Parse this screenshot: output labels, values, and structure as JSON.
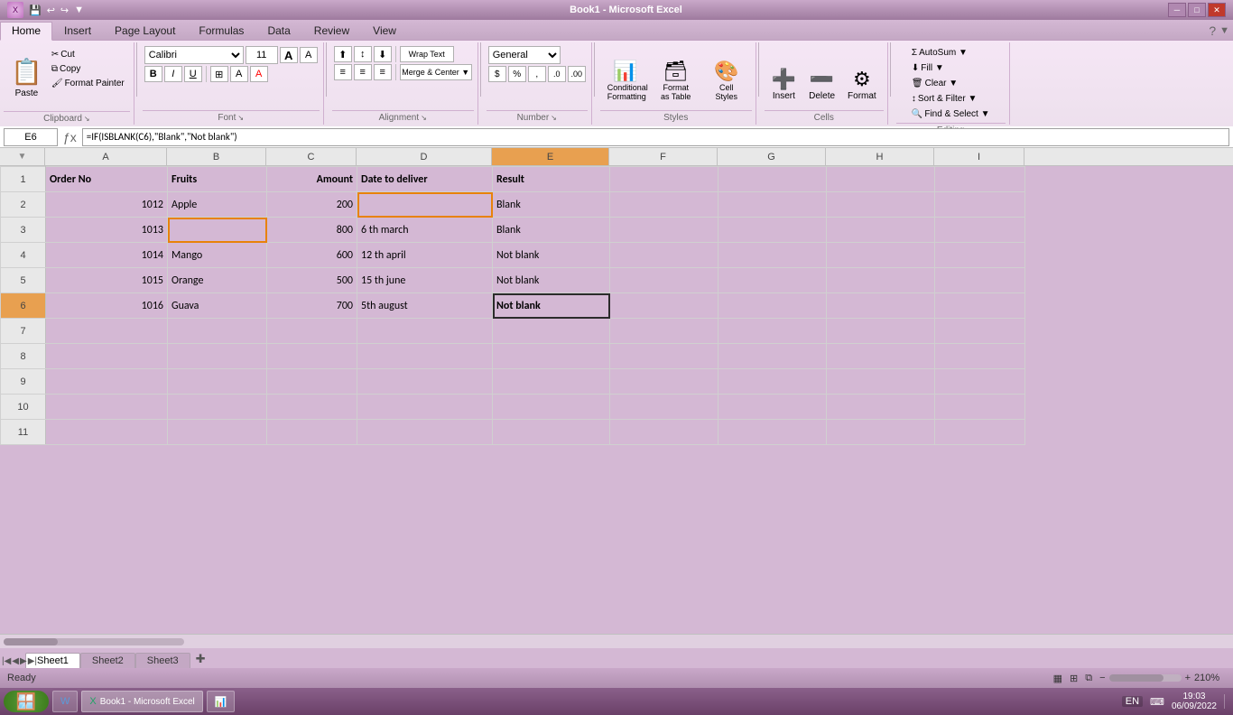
{
  "titlebar": {
    "title": "Book1 - Microsoft Excel",
    "minimize": "─",
    "restore": "□",
    "close": "✕"
  },
  "ribbon_tabs": [
    "Home",
    "Insert",
    "Page Layout",
    "Formulas",
    "Data",
    "Review",
    "View"
  ],
  "active_tab": "Home",
  "clipboard_group": {
    "label": "Clipboard",
    "paste": "Paste",
    "cut": "Cut",
    "copy": "Copy",
    "format_painter": "Format Painter"
  },
  "font_group": {
    "label": "Font",
    "font_name": "Calibri",
    "font_size": "11",
    "bold": "B",
    "italic": "I",
    "underline": "U"
  },
  "alignment_group": {
    "label": "Alignment",
    "wrap_text": "Wrap Text",
    "merge_center": "Merge & Center ▼"
  },
  "number_group": {
    "label": "Number",
    "format": "General"
  },
  "styles_group": {
    "label": "Styles",
    "conditional": "Conditional Formatting",
    "format_table": "Format as Table",
    "cell_styles": "Cell Styles"
  },
  "cells_group": {
    "label": "Cells",
    "insert": "Insert",
    "delete": "Delete",
    "format": "Format"
  },
  "editing_group": {
    "label": "Editing",
    "autosum": "AutoSum ▼",
    "fill": "Fill ▼",
    "clear": "Clear ▼",
    "sort_filter": "Sort & Filter ▼",
    "find_select": "Find & Select ▼"
  },
  "formula_bar": {
    "cell_ref": "E6",
    "formula": "=IF(ISBLANK(C6),\"Blank\",\"Not blank\")"
  },
  "columns": [
    "A",
    "B",
    "C",
    "D",
    "E",
    "F",
    "G",
    "H",
    "I"
  ],
  "rows": [
    1,
    2,
    3,
    4,
    5,
    6,
    7,
    8,
    9,
    10,
    11
  ],
  "headers": [
    "Order No",
    "Fruits",
    "Amount",
    "Date to deliver",
    "Result",
    "",
    "",
    "",
    ""
  ],
  "data": [
    [
      "1012",
      "Apple",
      "200",
      "",
      "Blank"
    ],
    [
      "1013",
      "",
      "800",
      "6 th march",
      "Blank"
    ],
    [
      "1014",
      "Mango",
      "600",
      "12 th april",
      "Not blank"
    ],
    [
      "1015",
      "Orange",
      "500",
      "15 th june",
      "Not blank"
    ],
    [
      "1016",
      "Guava",
      "700",
      "5th august",
      "Not blank"
    ]
  ],
  "sheet_tabs": [
    "Sheet1",
    "Sheet2",
    "Sheet3"
  ],
  "active_sheet": "Sheet1",
  "status": {
    "ready": "Ready",
    "zoom": "210%"
  },
  "taskbar": {
    "start": "start",
    "items": [
      "W",
      "Excel"
    ],
    "time": "19:03",
    "date": "06/09/2022",
    "lang": "EN"
  }
}
